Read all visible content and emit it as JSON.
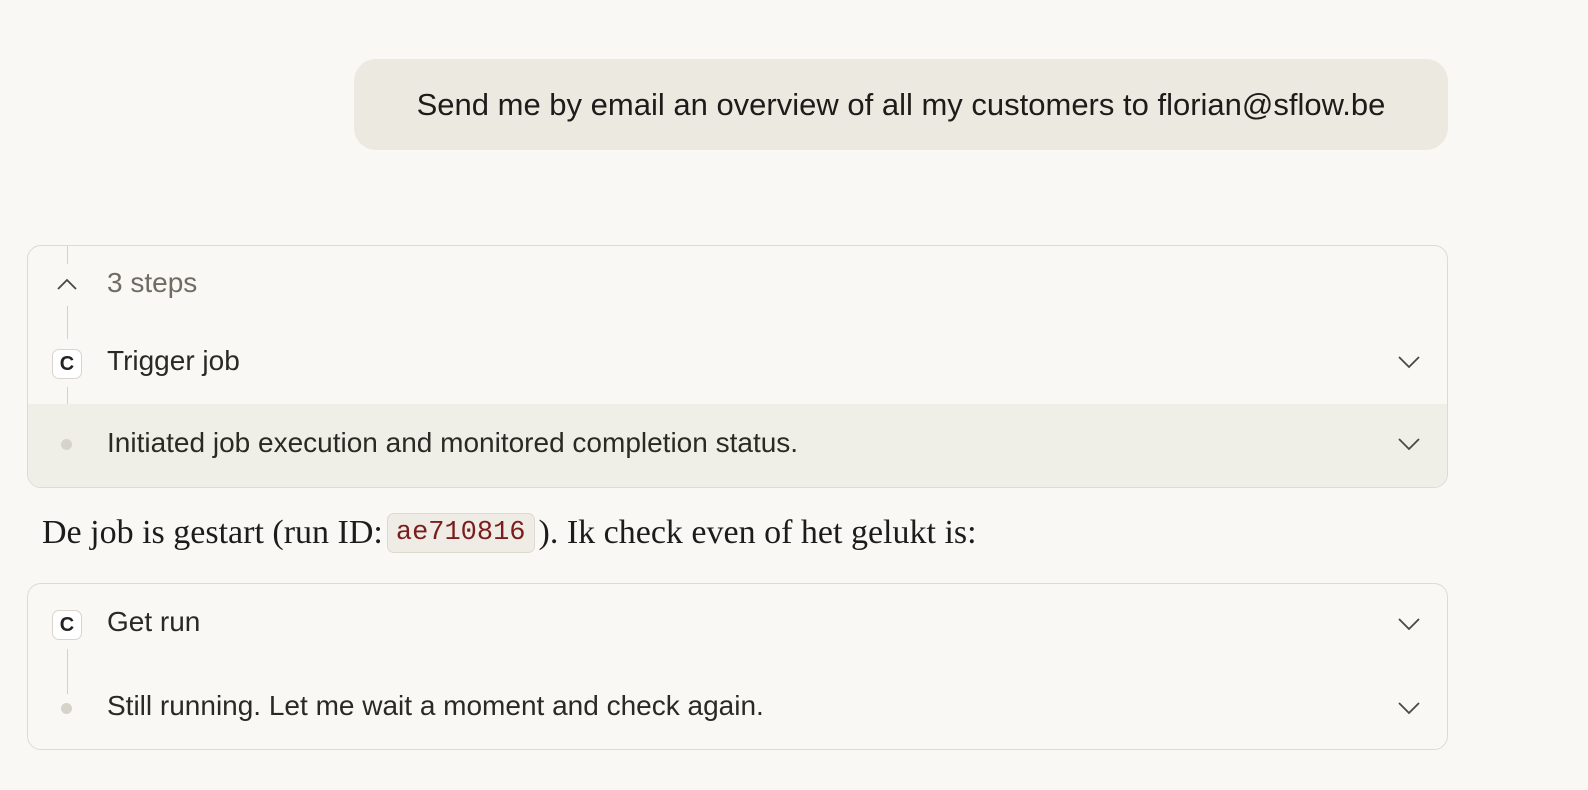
{
  "user_message": {
    "text": "Send me by email an overview of all my customers to florian@sflow.be"
  },
  "steps_card_1": {
    "summary_label": "3 steps",
    "toggle_icon": "chevron-up-icon",
    "steps": [
      {
        "badge": "C",
        "label": "Trigger job",
        "icon": "chevron-down-icon"
      },
      {
        "label": "Initiated job execution and monitored completion status.",
        "icon": "chevron-down-icon"
      }
    ]
  },
  "assistant": {
    "text_before": "De job is gestart (run ID: ",
    "run_id": "ae710816",
    "text_after": "). Ik check even of het gelukt is:"
  },
  "steps_card_2": {
    "steps": [
      {
        "badge": "C",
        "label": "Get run",
        "icon": "chevron-down-icon"
      },
      {
        "label": "Still running. Let me wait a moment and check again.",
        "icon": "chevron-down-icon"
      }
    ]
  },
  "colors": {
    "background": "#f9f8f4",
    "bubble": "#ece9e1",
    "code_text": "#7a1d1d",
    "highlight_row": "#f0efe7"
  }
}
